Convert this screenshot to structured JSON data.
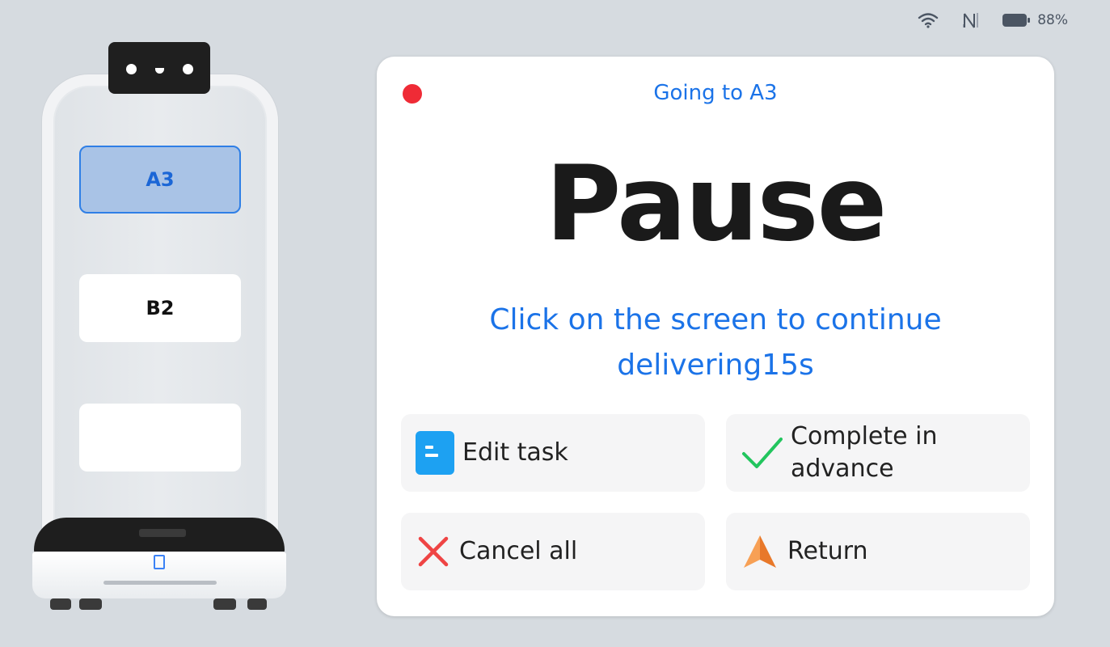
{
  "status_bar": {
    "battery_percent": "88%",
    "icons": [
      "wifi-icon",
      "no-signal-icon",
      "battery-icon"
    ]
  },
  "robot": {
    "trays": [
      {
        "label": "A3",
        "active": true
      },
      {
        "label": "B2",
        "active": false
      },
      {
        "label": "",
        "active": false
      }
    ]
  },
  "dialog": {
    "subtitle": "Going to A3",
    "title": "Pause",
    "message": "Click on the screen to continue delivering15s",
    "actions": {
      "edit_task": {
        "label": "Edit task",
        "icon": "document-icon"
      },
      "complete_in_advance": {
        "label": "Complete in advance",
        "icon": "checkmark-icon"
      },
      "cancel_all": {
        "label": "Cancel all",
        "icon": "close-icon"
      },
      "return": {
        "label": "Return",
        "icon": "navigation-arrow-icon"
      }
    }
  },
  "colors": {
    "accent": "#1b73e8",
    "record": "#ef2b36",
    "check": "#22c55e",
    "cancel": "#ef4444",
    "return": "#f08a3c",
    "doc": "#1da1f2"
  }
}
